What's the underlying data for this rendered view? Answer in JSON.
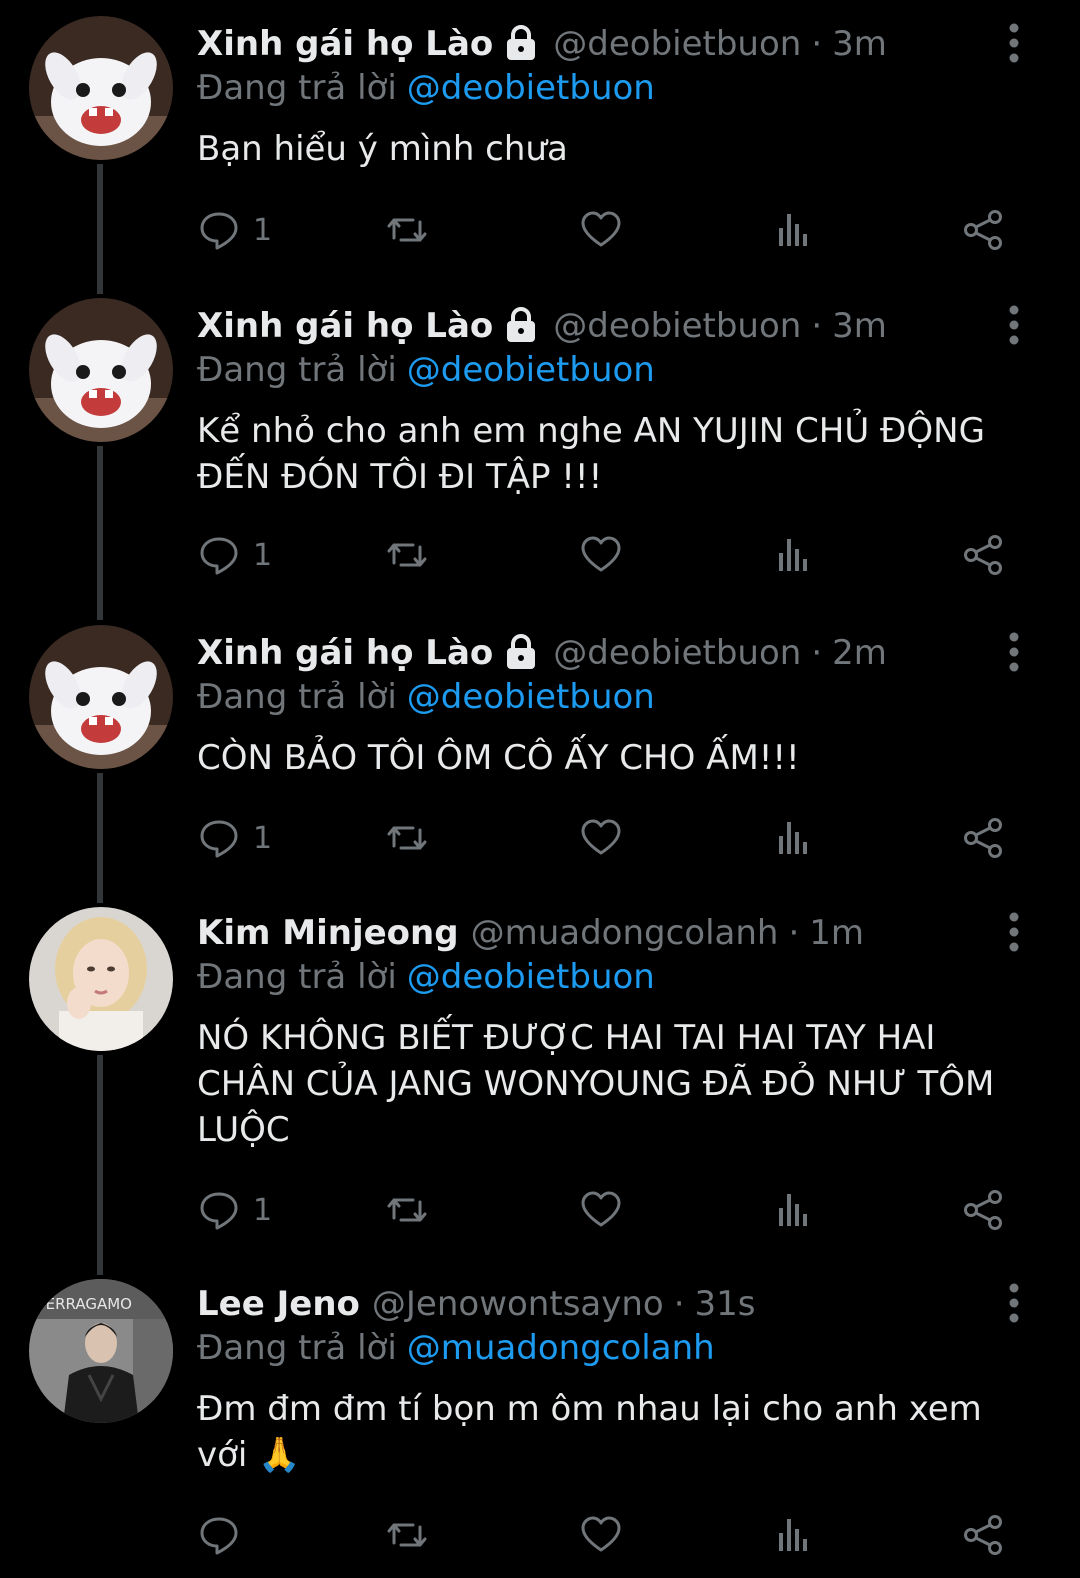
{
  "colors": {
    "background": "#000000",
    "text": "#e7e9ea",
    "secondary": "#71767b",
    "accent": "#1d9bf0",
    "thread_line": "#333639"
  },
  "tweets": [
    {
      "display_name": "Xinh gái họ Lào",
      "protected": true,
      "handle": "@deobietbuon",
      "separator": "·",
      "time": "3m",
      "reply_prefix": "Đang trả lời",
      "reply_to": "@deobietbuon",
      "text": "Bạn hiểu ý mình chưa",
      "reply_count": "1",
      "avatar": "white-rabbit-avatar"
    },
    {
      "display_name": "Xinh gái họ Lào",
      "protected": true,
      "handle": "@deobietbuon",
      "separator": "·",
      "time": "3m",
      "reply_prefix": "Đang trả lời",
      "reply_to": "@deobietbuon",
      "text": "Kể nhỏ cho anh em nghe AN YUJIN CHỦ ĐỘNG ĐẾN ĐÓN TÔI ĐI TẬP !!!",
      "reply_count": "1",
      "avatar": "white-rabbit-avatar"
    },
    {
      "display_name": "Xinh gái họ Lào",
      "protected": true,
      "handle": "@deobietbuon",
      "separator": "·",
      "time": "2m",
      "reply_prefix": "Đang trả lời",
      "reply_to": "@deobietbuon",
      "text": "CÒN BẢO TÔI ÔM CÔ ẤY CHO ẤM!!!",
      "reply_count": "1",
      "avatar": "white-rabbit-avatar"
    },
    {
      "display_name": "Kim Minjeong",
      "protected": false,
      "handle": "@muadongcolanh",
      "separator": "·",
      "time": "1m",
      "reply_prefix": "Đang trả lời",
      "reply_to": "@deobietbuon",
      "text": "NÓ KHÔNG BIẾT ĐƯỢC HAI TAI HAI TAY HAI CHÂN CỦA JANG WONYOUNG ĐÃ ĐỎ NHƯ TÔM LUỘC",
      "reply_count": "1",
      "avatar": "blonde-girl-avatar"
    },
    {
      "display_name": "Lee Jeno",
      "protected": false,
      "handle": "@Jenowontsayno",
      "separator": "·",
      "time": "31s",
      "reply_prefix": "Đang trả lời",
      "reply_to": "@muadongcolanh",
      "text": "Đm đm đm tí bọn m ôm nhau lại cho anh xem với 🙏",
      "reply_count": "",
      "avatar": "ferragamo-man-avatar",
      "avatar_sign_text": "FERRAGAMO"
    }
  ],
  "icons": {
    "reply": "reply-icon",
    "retweet": "retweet-icon",
    "like": "heart-icon",
    "views": "views-icon",
    "share": "share-icon",
    "more": "more-vertical-icon",
    "lock": "lock-icon"
  }
}
